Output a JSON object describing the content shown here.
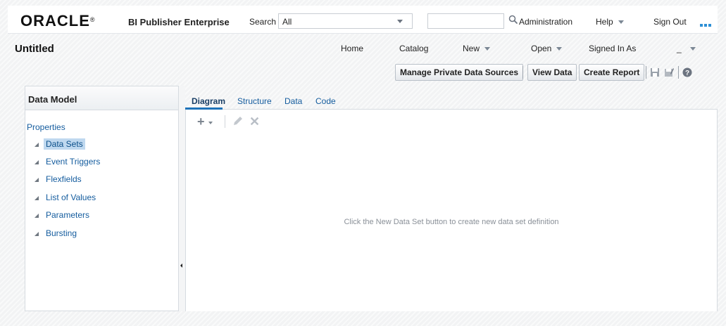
{
  "app": {
    "logo": "ORACLE",
    "product": "BI Publisher Enterprise"
  },
  "search": {
    "label": "Search",
    "scope_value": "All",
    "placeholder": ""
  },
  "topnav": {
    "administration": "Administration",
    "help": "Help",
    "sign_out": "Sign Out"
  },
  "header": {
    "title": "Untitled",
    "nav": {
      "home": "Home",
      "catalog": "Catalog",
      "new": "New",
      "open": "Open",
      "signed_in_as": "Signed In As",
      "user": "_"
    }
  },
  "toolbar": {
    "manage_private": "Manage Private Data Sources",
    "view_data": "View Data",
    "create_report": "Create Report"
  },
  "left_panel": {
    "title": "Data Model",
    "properties": "Properties",
    "items": [
      {
        "label": "Data Sets",
        "selected": true
      },
      {
        "label": "Event Triggers"
      },
      {
        "label": "Flexfields"
      },
      {
        "label": "List of Values"
      },
      {
        "label": "Parameters"
      },
      {
        "label": "Bursting"
      }
    ]
  },
  "tabs": [
    {
      "label": "Diagram",
      "active": true
    },
    {
      "label": "Structure"
    },
    {
      "label": "Data"
    },
    {
      "label": "Code"
    }
  ],
  "main": {
    "empty_message": "Click the New Data Set button to create new data set definition"
  },
  "colors": {
    "accent": "#1e73b9",
    "link": "#145c9e",
    "selected_bg": "#bfd8ef"
  }
}
